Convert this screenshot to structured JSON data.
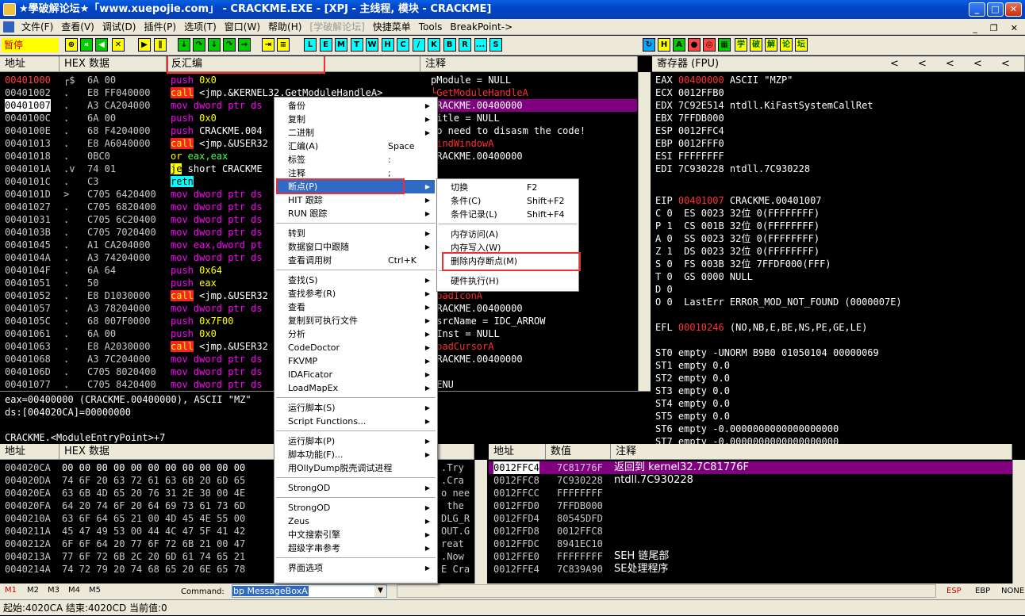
{
  "window": {
    "title": "★學破解论坛★「www.xuepojie.com」 - CRACKME.EXE - [XPJ - 主线程, 模块 - CRACKME]"
  },
  "menu": [
    "文件(F)",
    "查看(V)",
    "调试(D)",
    "插件(P)",
    "选项(T)",
    "窗口(W)",
    "帮助(H)",
    "[学破解论坛]",
    "快捷菜单",
    "Tools",
    "BreakPoint->"
  ],
  "toolbar": {
    "status": "暂停",
    "letters": [
      "L",
      "E",
      "M",
      "T",
      "W",
      "H",
      "C",
      "/",
      "K",
      "B",
      "R",
      "...",
      "S"
    ],
    "brand": [
      "学",
      "破",
      "解",
      "论",
      "坛"
    ]
  },
  "headers": {
    "addr": "地址",
    "hex": "HEX 数据",
    "disasm": "反汇编",
    "comment": "注释",
    "registers": "寄存器 (FPU)",
    "stack_addr": "地址",
    "stack_val": "数值",
    "stack_comment": "注释"
  },
  "disasm": [
    {
      "a": "00401000",
      "h": "6A 00",
      "op": "push",
      "arg": " 0x0",
      "c": "pModule = NULL",
      "mk": "┌$"
    },
    {
      "a": "00401002",
      "h": "E8 FF040000",
      "op": "call",
      "arg": " <jmp.&KERNEL32.GetModuleHandleA>",
      "c": "└GetModuleHandleA",
      "mk": "."
    },
    {
      "a": "00401007",
      "h": "A3 CA204000",
      "op": "mov",
      "arg": " dword ptr ds",
      "c": "CRACKME.00400000",
      "mk": "."
    },
    {
      "a": "0040100C",
      "h": "6A 00",
      "op": "push",
      "arg": " 0x0",
      "c": "Title = NULL",
      "mk": "."
    },
    {
      "a": "0040100E",
      "h": "68 F4204000",
      "op": "push",
      "arg": " CRACKME.004",
      "c": "No need to disasm the code!",
      "mk": "."
    },
    {
      "a": "00401013",
      "h": "E8 A6040000",
      "op": "call",
      "arg": " <jmp.&USER32",
      "c": "FindWindowA",
      "mk": "."
    },
    {
      "a": "00401018",
      "h": "0BC0",
      "op": "or",
      "arg": " eax,eax",
      "c": "CRACKME.00400000",
      "mk": "."
    },
    {
      "a": "0040101A",
      "h": "74 01",
      "op": "je",
      "arg": " short CRACKME",
      "c": "",
      "mk": ".v"
    },
    {
      "a": "0040101C",
      "h": "C3",
      "op": "retn",
      "arg": "",
      "c": "",
      "mk": "."
    },
    {
      "a": "0040101D",
      "h": "C705 6420400",
      "op": "mov",
      "arg": " dword ptr ds",
      "c": "",
      "mk": ">"
    },
    {
      "a": "00401027",
      "h": "C705 6820400",
      "op": "mov",
      "arg": " dword ptr ds",
      "c": "",
      "mk": "."
    },
    {
      "a": "00401031",
      "h": "C705 6C20400",
      "op": "mov",
      "arg": " dword ptr ds",
      "c": "",
      "mk": "."
    },
    {
      "a": "0040103B",
      "h": "C705 7020400",
      "op": "mov",
      "arg": " dword ptr ds",
      "c": "",
      "mk": "."
    },
    {
      "a": "00401045",
      "h": "A1 CA204000",
      "op": "mov",
      "arg": " eax,dword pt",
      "c": "",
      "mk": "."
    },
    {
      "a": "0040104A",
      "h": "A3 74204000",
      "op": "mov",
      "arg": " dword ptr ds",
      "c": "",
      "mk": "."
    },
    {
      "a": "0040104F",
      "h": "6A 64",
      "op": "push",
      "arg": " 0x64",
      "c": "",
      "mk": "."
    },
    {
      "a": "00401051",
      "h": "50",
      "op": "push",
      "arg": " eax",
      "c": "",
      "mk": "."
    },
    {
      "a": "00401052",
      "h": "E8 D1030000",
      "op": "call",
      "arg": " <jmp.&USER32",
      "c": "LoadIconA",
      "mk": "."
    },
    {
      "a": "00401057",
      "h": "A3 78204000",
      "op": "mov",
      "arg": " dword ptr ds",
      "c": "CRACKME.00400000",
      "mk": "."
    },
    {
      "a": "0040105C",
      "h": "68 007F0000",
      "op": "push",
      "arg": " 0x7F00",
      "c": "RsrcName = IDC_ARROW",
      "mk": "."
    },
    {
      "a": "00401061",
      "h": "6A 00",
      "op": "push",
      "arg": " 0x0",
      "c": "hInst = NULL",
      "mk": "."
    },
    {
      "a": "00401063",
      "h": "E8 A2030000",
      "op": "call",
      "arg": " <jmp.&USER32",
      "c": "LoadCursorA",
      "mk": "."
    },
    {
      "a": "00401068",
      "h": "A3 7C204000",
      "op": "mov",
      "arg": " dword ptr ds",
      "c": "CRACKME.00400000",
      "mk": "."
    },
    {
      "a": "0040106D",
      "h": "C705 8020400",
      "op": "mov",
      "arg": " dword ptr ds",
      "c": "",
      "mk": "."
    },
    {
      "a": "00401077",
      "h": "C705 8420400",
      "op": "mov",
      "arg": " dword ptr ds",
      "c": "MENU",
      "mk": "."
    }
  ],
  "info": [
    "eax=00400000 (CRACKME.00400000), ASCII \"MZ\"",
    "ds:[004020CA]=00000000",
    "",
    "CRACKME.<ModuleEntryPoint>+7"
  ],
  "registers": [
    {
      "n": "EAX",
      "v": "00400000",
      "d": "ASCII \"MZP\"",
      "hl": true
    },
    {
      "n": "ECX",
      "v": "0012FFB0",
      "d": ""
    },
    {
      "n": "EDX",
      "v": "7C92E514",
      "d": "ntdll.KiFastSystemCallRet"
    },
    {
      "n": "EBX",
      "v": "7FFDB000",
      "d": ""
    },
    {
      "n": "ESP",
      "v": "0012FFC4",
      "d": ""
    },
    {
      "n": "EBP",
      "v": "0012FFF0",
      "d": ""
    },
    {
      "n": "ESI",
      "v": "FFFFFFFF",
      "d": ""
    },
    {
      "n": "EDI",
      "v": "7C930228",
      "d": "ntdll.7C930228"
    },
    {
      "n": "",
      "v": "",
      "d": ""
    },
    {
      "n": "EIP",
      "v": "00401007",
      "d": "CRACKME.00401007",
      "hl": true
    }
  ],
  "flags": [
    "C 0  ES 0023 32位 0(FFFFFFFF)",
    "P 1  CS 001B 32位 0(FFFFFFFF)",
    "A 0  SS 0023 32位 0(FFFFFFFF)",
    "Z 1  DS 0023 32位 0(FFFFFFFF)",
    "S 0  FS 003B 32位 7FFDF000(FFF)",
    "T 0  GS 0000 NULL",
    "D 0",
    "O 0  LastErr ERROR_MOD_NOT_FOUND (0000007E)",
    "",
    "EFL 00010246 (NO,NB,E,BE,NS,PE,GE,LE)",
    "",
    "ST0 empty -UNORM B9B0 01050104 00000069",
    "ST1 empty 0.0",
    "ST2 empty 0.0",
    "ST3 empty 0.0",
    "ST4 empty 0.0",
    "ST5 empty 0.0",
    "ST6 empty -0.0000000000000000000",
    "ST7 empty -0.0000000000000000000",
    "             3 2 1 0      E S P U O Z D I"
  ],
  "dump": [
    {
      "a": "004020CA",
      "h": "00 00 00 00 00 00 00 00 00 00 00",
      "t": ".Try"
    },
    {
      "a": "004020DA",
      "h": "74 6F 20 63 72 61 63 6B 20 6D 65",
      "t": ".Cra"
    },
    {
      "a": "004020EA",
      "h": "63 6B 4D 65 20 76 31 2E 30 00 4E",
      "t": "o nee"
    },
    {
      "a": "004020FA",
      "h": "64 20 74 6F 20 64 69 73 61 73 6D",
      "t": " the"
    },
    {
      "a": "0040210A",
      "h": "63 6F 64 65 21 00 4D 45 4E 55 00",
      "t": "DLG_R"
    },
    {
      "a": "0040211A",
      "h": "45 47 49 53 00 44 4C 47 5F 41 42",
      "t": "OUT.G"
    },
    {
      "a": "0040212A",
      "h": "6F 6F 64 20 77 6F 72 6B 21 00 47",
      "t": "reat"
    },
    {
      "a": "0040213A",
      "h": "77 6F 72 6B 2C 20 6D 61 74 65 21",
      "t": ".Now"
    },
    {
      "a": "0040214A",
      "h": "74 72 79 20 74 68 65 20 6E 65 78",
      "t": "E Cra"
    }
  ],
  "stack": [
    {
      "a": "0012FFC4",
      "v": "7C81776F",
      "c": "返回到 kernel32.7C81776F",
      "sel": true
    },
    {
      "a": "0012FFC8",
      "v": "7C930228",
      "c": "ntdll.7C930228"
    },
    {
      "a": "0012FFCC",
      "v": "FFFFFFFF",
      "c": ""
    },
    {
      "a": "0012FFD0",
      "v": "7FFDB000",
      "c": ""
    },
    {
      "a": "0012FFD4",
      "v": "80545DFD",
      "c": ""
    },
    {
      "a": "0012FFD8",
      "v": "0012FFC8",
      "c": ""
    },
    {
      "a": "0012FFDC",
      "v": "8941EC10",
      "c": ""
    },
    {
      "a": "0012FFE0",
      "v": "FFFFFFFF",
      "c": "SEH 链尾部"
    },
    {
      "a": "0012FFE4",
      "v": "7C839A90",
      "c": "SE处理程序"
    }
  ],
  "context_menu": [
    {
      "l": "备份",
      "k": "",
      "s": true
    },
    {
      "l": "复制",
      "k": "",
      "s": true
    },
    {
      "l": "二进制",
      "k": "",
      "s": true
    },
    {
      "l": "汇编(A)",
      "k": "Space"
    },
    {
      "l": "标签",
      "k": ":"
    },
    {
      "l": "注释",
      "k": ";"
    },
    {
      "l": "断点(P)",
      "k": "",
      "s": true,
      "hi": true
    },
    {
      "l": "HIT 跟踪",
      "k": "",
      "s": true
    },
    {
      "l": "RUN 跟踪",
      "k": "",
      "s": true
    },
    {
      "sep": true
    },
    {
      "l": "转到",
      "k": "",
      "s": true
    },
    {
      "l": "数据窗口中跟随",
      "k": "",
      "s": true
    },
    {
      "l": "查看调用树",
      "k": "Ctrl+K"
    },
    {
      "sep": true
    },
    {
      "l": "查找(S)",
      "k": "",
      "s": true
    },
    {
      "l": "查找参考(R)",
      "k": "",
      "s": true
    },
    {
      "l": "查看",
      "k": "",
      "s": true
    },
    {
      "l": "复制到可执行文件",
      "k": "",
      "s": true
    },
    {
      "l": "分析",
      "k": "",
      "s": true
    },
    {
      "l": "CodeDoctor",
      "k": "",
      "s": true
    },
    {
      "l": "FKVMP",
      "k": "",
      "s": true
    },
    {
      "l": "IDAFicator",
      "k": "",
      "s": true
    },
    {
      "l": "LoadMapEx",
      "k": "",
      "s": true
    },
    {
      "sep": true
    },
    {
      "l": "运行脚本(S)",
      "k": "",
      "s": true
    },
    {
      "l": "Script Functions...",
      "k": "",
      "s": true
    },
    {
      "sep": true
    },
    {
      "l": "运行脚本(P)",
      "k": "",
      "s": true
    },
    {
      "l": "脚本功能(F)...",
      "k": "",
      "s": true
    },
    {
      "l": "用OllyDump脱壳调试进程",
      "k": ""
    },
    {
      "sep": true
    },
    {
      "l": "StrongOD",
      "k": "",
      "s": true
    },
    {
      "sep": true
    },
    {
      "l": "StrongOD",
      "k": "",
      "s": true
    },
    {
      "l": "Zeus",
      "k": "",
      "s": true
    },
    {
      "l": "中文搜索引擎",
      "k": "",
      "s": true
    },
    {
      "l": "超级字串参考",
      "k": "",
      "s": true
    },
    {
      "sep": true
    },
    {
      "l": "界面选项",
      "k": "",
      "s": true
    }
  ],
  "submenu": [
    {
      "l": "切换",
      "k": "F2"
    },
    {
      "l": "条件(C)",
      "k": "Shift+F2"
    },
    {
      "l": "条件记录(L)",
      "k": "Shift+F4"
    },
    {
      "sep": true
    },
    {
      "l": "内存访问(A)",
      "k": ""
    },
    {
      "l": "内存写入(W)",
      "k": ""
    },
    {
      "l": "删除内存断点(M)",
      "k": ""
    },
    {
      "sep": true
    },
    {
      "l": "硬件执行(H)",
      "k": ""
    }
  ],
  "command": {
    "label": "Command:",
    "value": "bp MessageBoxA",
    "tabs": [
      "M1",
      "M2",
      "M3",
      "M4",
      "M5"
    ],
    "right": [
      "ESP",
      "EBP",
      "NONE"
    ]
  },
  "status": "起始:4020CA 结束:4020CD 当前值:0"
}
